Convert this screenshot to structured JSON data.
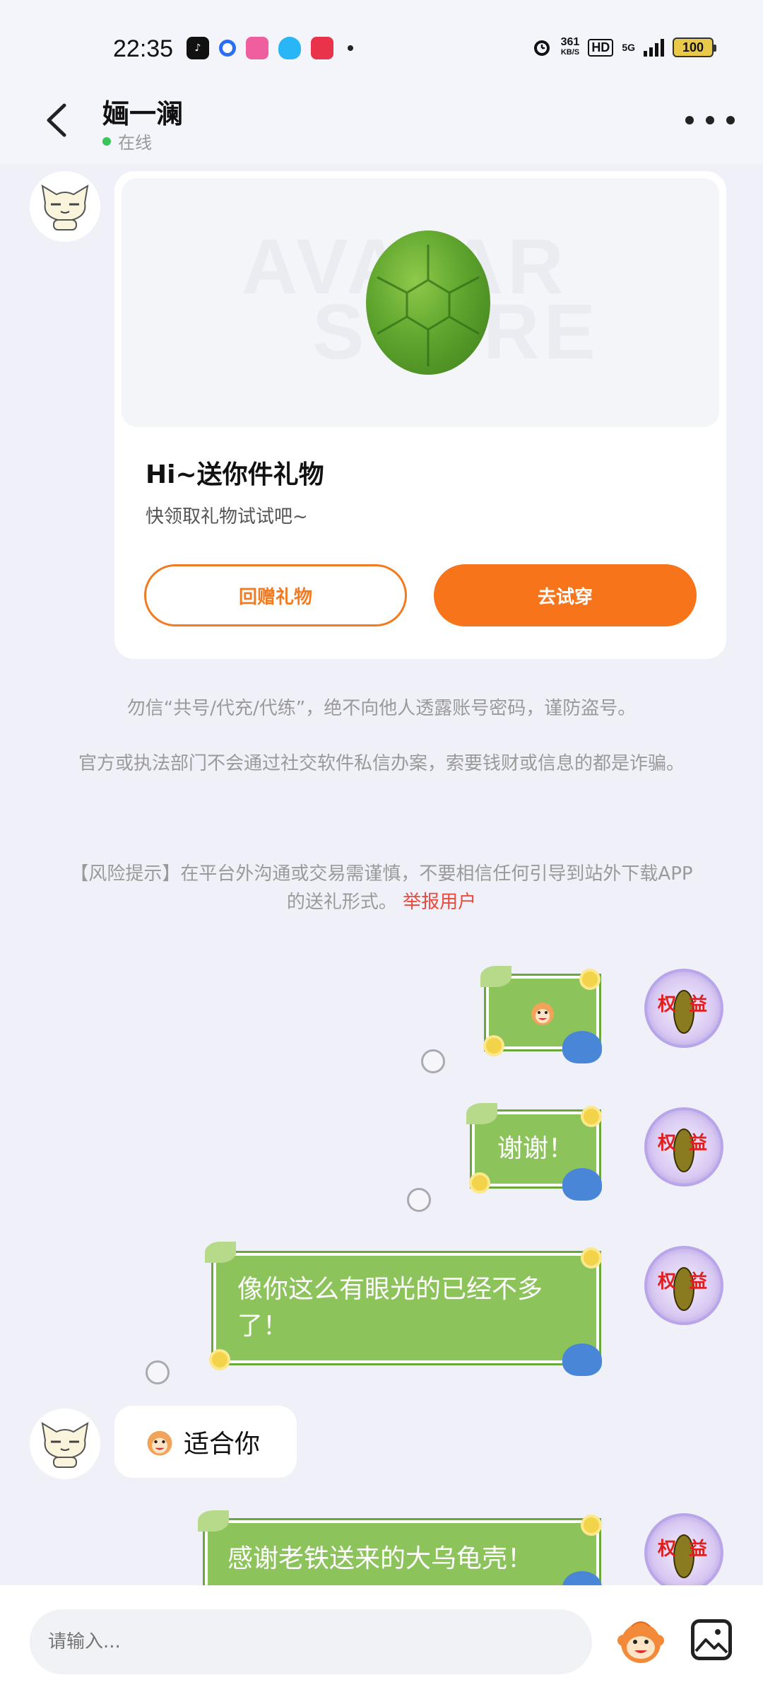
{
  "status_bar": {
    "time": "22:35",
    "net_speed_value": "361",
    "net_speed_unit": "KB/S",
    "hd_label": "HD",
    "network": "5G",
    "battery": "100"
  },
  "header": {
    "title": "婳一澜",
    "status": "在线"
  },
  "gift_card": {
    "watermark_line1": "AVATAR",
    "watermark_line2": "STORE",
    "title": "Hi~送你件礼物",
    "subtitle": "快领取礼物试试吧~",
    "return_gift_label": "回赠礼物",
    "try_on_label": "去试穿"
  },
  "notices": {
    "notice1": "勿信“共号/代充/代练”，绝不向他人透露账号密码，谨防盗号。",
    "notice2": "官方或执法部门不会通过社交软件私信办案，索要钱财或信息的都是诈骗。",
    "risk_text": "【风险提示】在平台外沟通或交易需谨慎，不要相信任何引导到站外下载APP的送礼形式。",
    "report_label": "举报用户"
  },
  "messages": {
    "m2": "谢谢！",
    "m3": "像你这么有眼光的已经不多了！",
    "m4": "适合你",
    "m5": "感谢老铁送来的大乌龟壳！"
  },
  "avatar_badge": {
    "left_char": "权",
    "right_char": "益"
  },
  "input": {
    "placeholder": "请输入..."
  },
  "colors": {
    "accent_orange": "#f8741a",
    "bubble_green": "#8cc35a",
    "online_green": "#3cc45c",
    "report_red": "#e84a3c"
  }
}
